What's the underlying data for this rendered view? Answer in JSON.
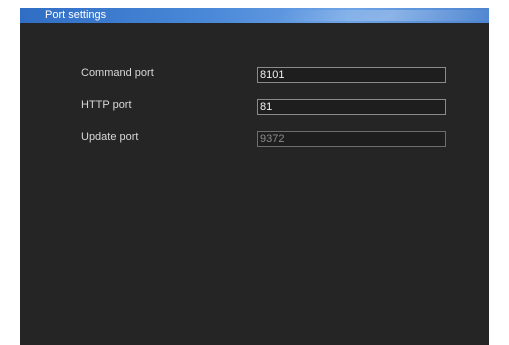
{
  "window": {
    "title": "Port settings"
  },
  "fields": [
    {
      "label": "Command port",
      "value": "8101",
      "editable": true
    },
    {
      "label": "HTTP port",
      "value": "81",
      "editable": true
    },
    {
      "label": "Update port",
      "value": "9372",
      "editable": false
    }
  ],
  "colors": {
    "panel_background": "#252525",
    "titlebar_accent": "#4a88d8",
    "label_text": "#d8d8d8"
  }
}
